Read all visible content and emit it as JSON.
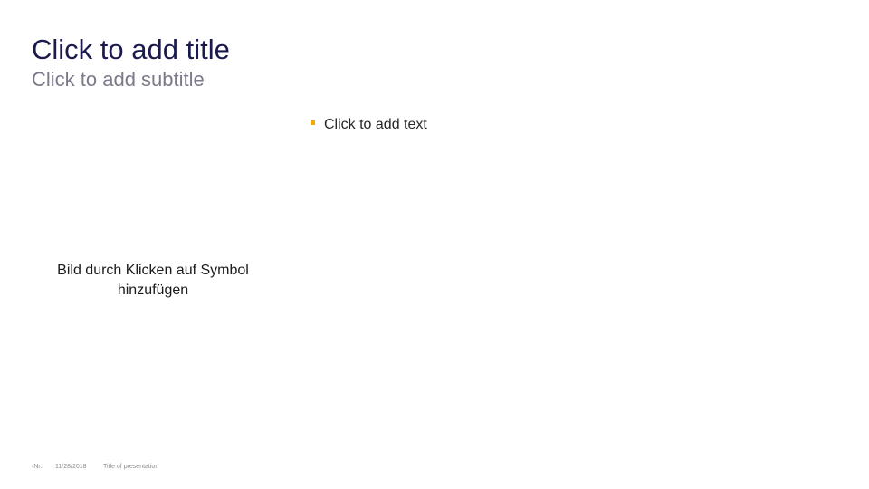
{
  "slide": {
    "title": "Click to add title",
    "subtitle": "Click to add subtitle",
    "body_text": "Click to add text",
    "picture_placeholder": "Bild durch Klicken auf Symbol hinzufügen",
    "footer": {
      "page_number": "‹Nr.›",
      "date": "11/28/2018",
      "presentation_title": "Title of presentation"
    }
  },
  "colors": {
    "background": "#ffffff",
    "title": "#1b1a4e",
    "subtitle": "#7a7a8a",
    "body_text": "#262626",
    "bullet": "#f5a800",
    "picture_text": "#1a1a1a",
    "footer": "#8c8c8c"
  }
}
